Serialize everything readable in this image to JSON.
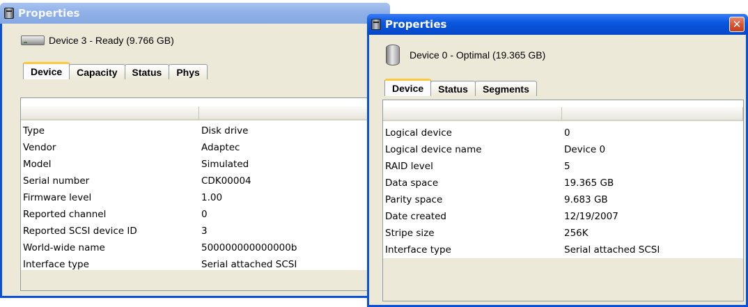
{
  "left_window": {
    "title": "Properties",
    "device_label": "Device 3 - Ready (9.766 GB)",
    "tabs": [
      {
        "label": "Device",
        "active": true
      },
      {
        "label": "Capacity",
        "active": false
      },
      {
        "label": "Status",
        "active": false
      },
      {
        "label": "Phys",
        "active": false
      }
    ],
    "rows": [
      {
        "name": "Type",
        "value": "Disk drive"
      },
      {
        "name": "Vendor",
        "value": "Adaptec"
      },
      {
        "name": "Model",
        "value": "Simulated"
      },
      {
        "name": "Serial number",
        "value": "CDK00004"
      },
      {
        "name": "Firmware level",
        "value": "1.00"
      },
      {
        "name": "Reported channel",
        "value": "0"
      },
      {
        "name": "Reported SCSI device ID",
        "value": "3"
      },
      {
        "name": "World-wide name",
        "value": "500000000000000b"
      },
      {
        "name": "Interface type",
        "value": "Serial attached SCSI"
      }
    ]
  },
  "right_window": {
    "title": "Properties",
    "close_label": "✕",
    "device_label": "Device 0 - Optimal (19.365 GB)",
    "tabs": [
      {
        "label": "Device",
        "active": true
      },
      {
        "label": "Status",
        "active": false
      },
      {
        "label": "Segments",
        "active": false
      }
    ],
    "rows": [
      {
        "name": "Logical device",
        "value": "0"
      },
      {
        "name": "Logical device name",
        "value": "Device 0"
      },
      {
        "name": "RAID level",
        "value": "5"
      },
      {
        "name": "Data space",
        "value": "19.365 GB"
      },
      {
        "name": "Parity space",
        "value": "9.683 GB"
      },
      {
        "name": "Date created",
        "value": "12/19/2007"
      },
      {
        "name": "Stripe size",
        "value": "256K"
      },
      {
        "name": "Interface type",
        "value": "Serial attached SCSI"
      }
    ]
  },
  "colors": {
    "active_titlebar": "#0a59e0",
    "inactive_titlebar": "#8fb0e8",
    "window_face": "#ece9d8",
    "tab_highlight": "#ffc83c",
    "close_button": "#d8522f"
  }
}
